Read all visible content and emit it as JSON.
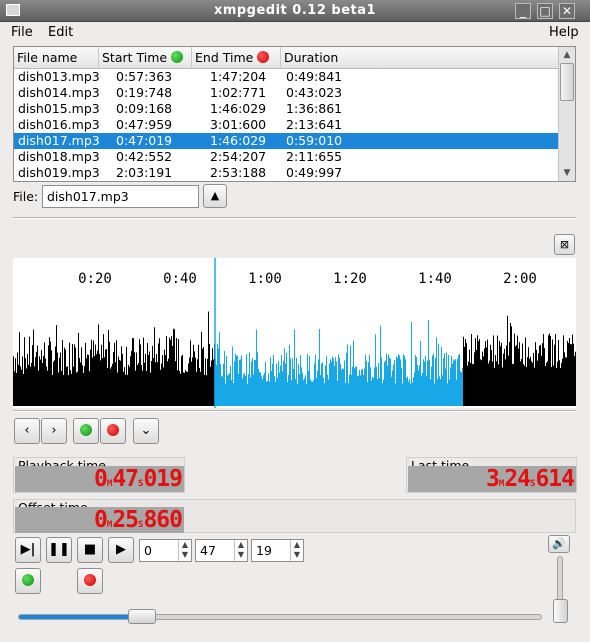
{
  "window": {
    "title": "xmpgedit 0.12 beta1",
    "min_glyph": "_",
    "max_glyph": "□",
    "close_glyph": "✕"
  },
  "menu": {
    "file": "File",
    "edit": "Edit",
    "help": "Help"
  },
  "list": {
    "headers": {
      "name": "File name",
      "start": "Start Time",
      "end": "End Time",
      "duration": "Duration"
    },
    "rows": [
      {
        "name": "dish013.mp3",
        "start": "0:57:363",
        "end": "1:47:204",
        "duration": "0:49:841"
      },
      {
        "name": "dish014.mp3",
        "start": "0:19:748",
        "end": "1:02:771",
        "duration": "0:43:023"
      },
      {
        "name": "dish015.mp3",
        "start": "0:09:168",
        "end": "1:46:029",
        "duration": "1:36:861"
      },
      {
        "name": "dish016.mp3",
        "start": "0:47:959",
        "end": "3:01:600",
        "duration": "2:13:641"
      },
      {
        "name": "dish017.mp3",
        "start": "0:47:019",
        "end": "1:46:029",
        "duration": "0:59:010"
      },
      {
        "name": "dish018.mp3",
        "start": "0:42:552",
        "end": "2:54:207",
        "duration": "2:11:655"
      },
      {
        "name": "dish019.mp3",
        "start": "2:03:191",
        "end": "2:53:188",
        "duration": "0:49:997"
      }
    ],
    "selected_index": 4
  },
  "file_field": {
    "label": "File:",
    "value": "dish017.mp3"
  },
  "waveform": {
    "ticks": [
      "0:20",
      "0:40",
      "1:00",
      "1:20",
      "1:40",
      "2:00"
    ]
  },
  "playback": {
    "label": "Playback time",
    "min": "0",
    "sec": "47",
    "ms": "019",
    "m_unit": "M",
    "s_unit": "S"
  },
  "last": {
    "label": "Last time",
    "min": "3",
    "sec": "24",
    "ms": "614",
    "m_unit": "M",
    "s_unit": "S"
  },
  "offset": {
    "label": "Offset time",
    "min": "0",
    "sec": "25",
    "ms": "860",
    "m_unit": "M",
    "s_unit": "S"
  },
  "spinners": {
    "minutes": "0",
    "seconds": "47",
    "fraction": "19"
  },
  "position_slider": {
    "value_fraction": 0.22
  },
  "volume_slider": {
    "value_fraction": 0.0
  },
  "colors": {
    "selection": "#1c87d8",
    "wave_selected": "#18a8e8",
    "wave": "#000000",
    "lcd_digits": "#e21010"
  },
  "icons": [
    "window-menu-icon",
    "minimize-icon",
    "maximize-icon",
    "close-icon",
    "green-dot-icon",
    "red-dot-icon",
    "scroll-up-icon",
    "scroll-down-icon",
    "collapse-up-icon",
    "close-panel-icon",
    "prev-icon",
    "next-icon",
    "chevron-down-icon",
    "skip-play-icon",
    "pause-icon",
    "stop-icon",
    "play-icon",
    "speaker-icon"
  ]
}
